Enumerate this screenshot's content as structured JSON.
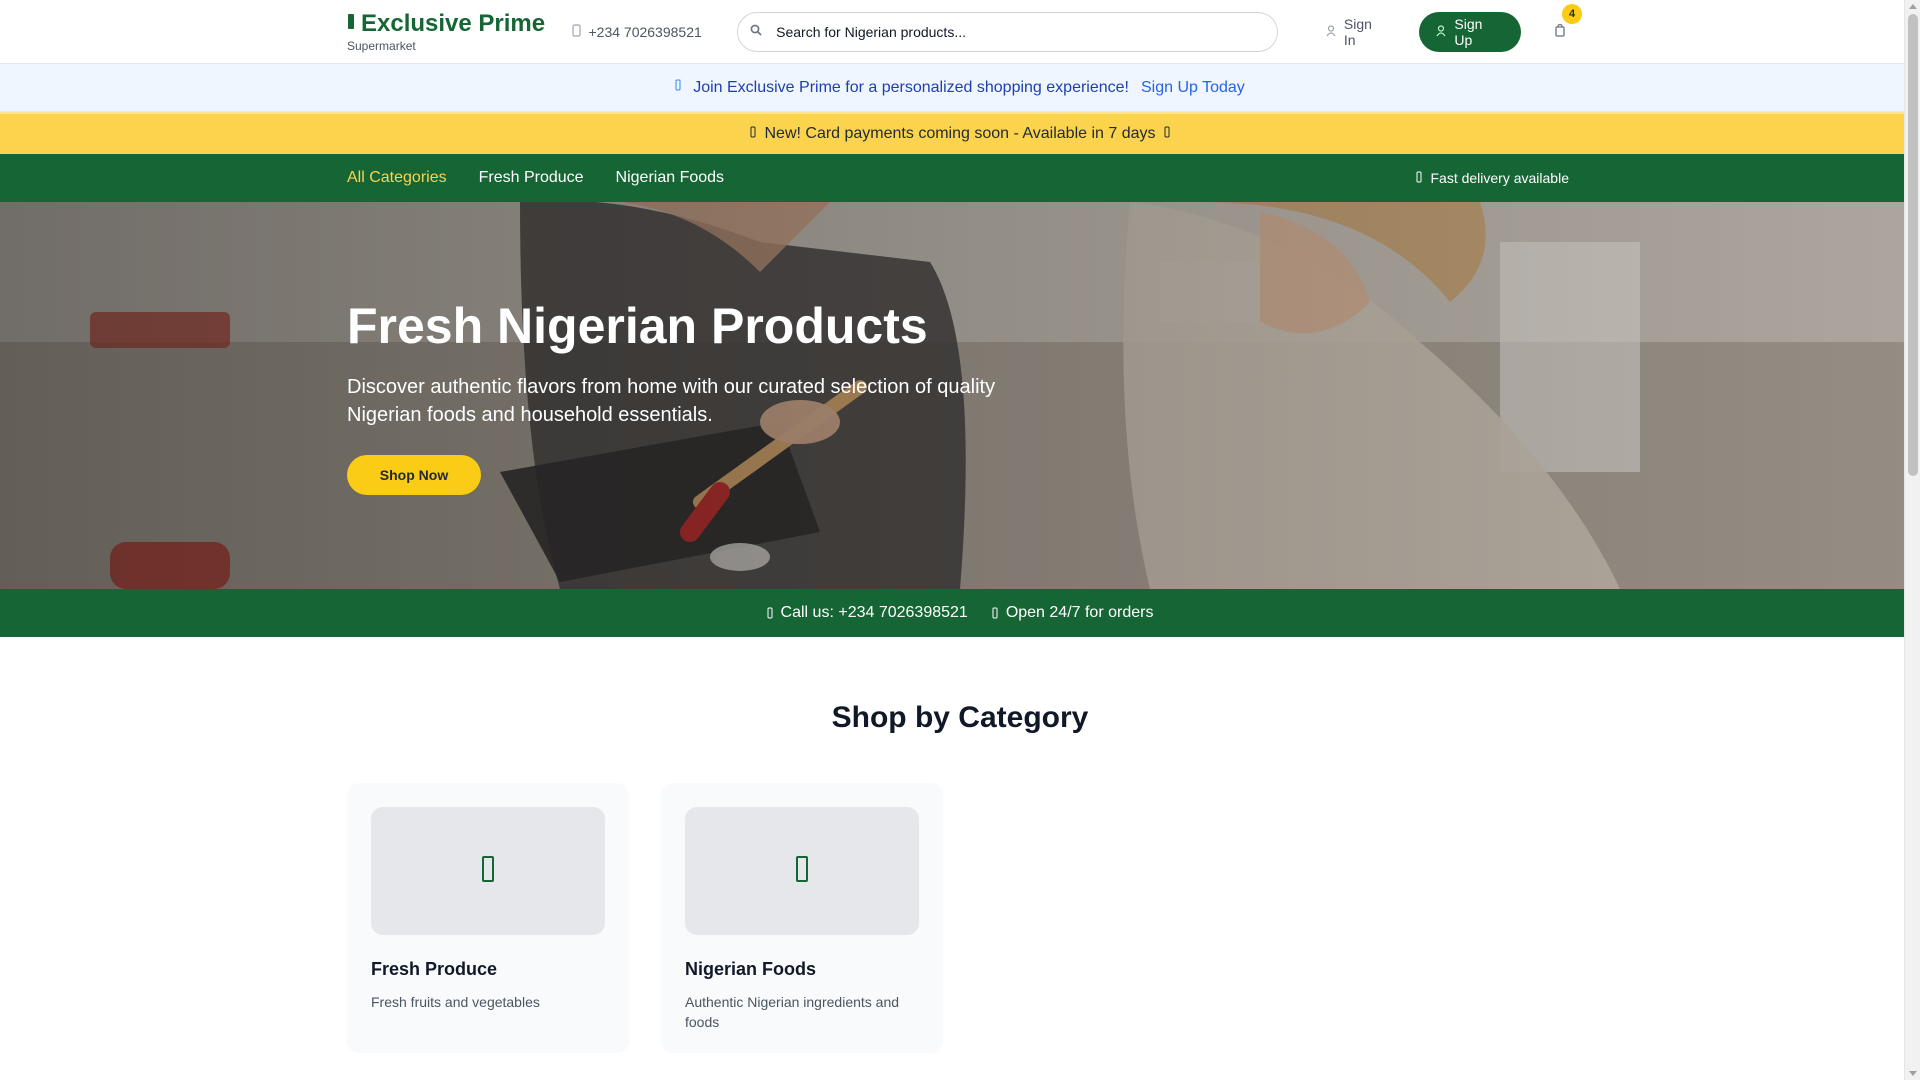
{
  "header": {
    "brand": "Exclusive Prime",
    "tagline": "Supermarket",
    "phone": "+234 7026398521",
    "search_placeholder": "Search for Nigerian products...",
    "signin_label": "Sign In",
    "signup_label": "Sign Up",
    "cart_count": "4"
  },
  "promo": {
    "text": "Join Exclusive Prime for a personalized shopping experience!",
    "link": "Sign Up Today"
  },
  "notice": {
    "text": "New! Card payments coming soon - Available in 7 days"
  },
  "nav": {
    "items": [
      {
        "label": "All Categories",
        "active": true
      },
      {
        "label": "Fresh Produce"
      },
      {
        "label": "Nigerian Foods"
      }
    ],
    "delivery": "Fast delivery available"
  },
  "hero": {
    "title": "Fresh Nigerian Products",
    "text": "Discover authentic flavors from home with our curated selection of quality Nigerian foods and household essentials.",
    "cta": "Shop Now"
  },
  "contact": {
    "call": "Call us: +234 7026398521",
    "hours": "Open 24/7 for orders"
  },
  "categories": {
    "title": "Shop by Category",
    "items": [
      {
        "name": "Fresh Produce",
        "desc": "Fresh fruits and vegetables",
        "icon": "leaf-icon"
      },
      {
        "name": "Nigerian Foods",
        "desc": "Authentic Nigerian ingredients and foods",
        "icon": "bowl-icon"
      }
    ]
  },
  "colors": {
    "brand_green": "#166534",
    "accent_yellow": "#facc15",
    "notice_yellow": "#fcd34d",
    "promo_bg": "#eff6ff"
  }
}
